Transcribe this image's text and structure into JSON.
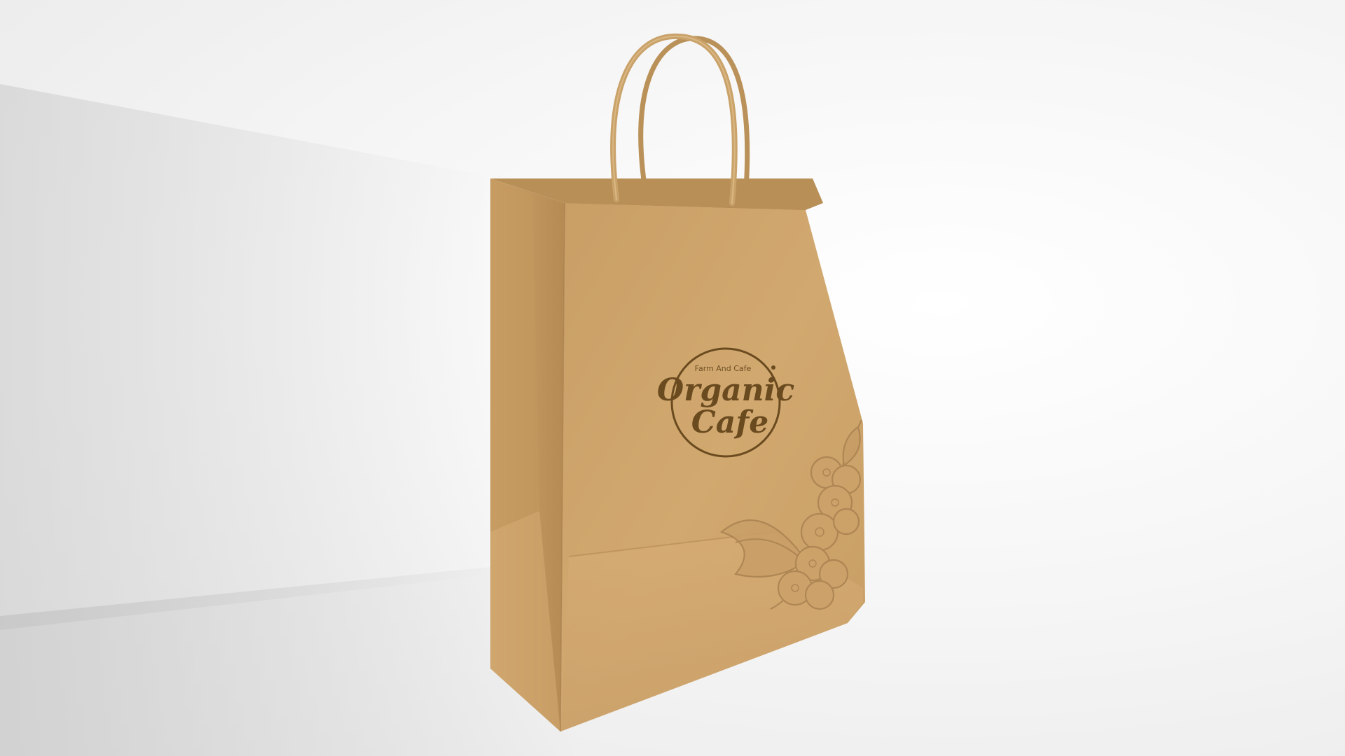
{
  "scene": {
    "description_role": "product mockup",
    "background_color": "#f4f4f4",
    "bag_color": "#cfa56d",
    "bag_shadow_color": "#a9834f",
    "handle_color": "#c9a26a",
    "print_color": "#6a4a1f"
  },
  "logo": {
    "subtitle": "Farm And Cafe",
    "line1": "Organic",
    "line2": "Cafe"
  },
  "icons": {
    "illustration": "coffee-cherry-branch-icon"
  }
}
